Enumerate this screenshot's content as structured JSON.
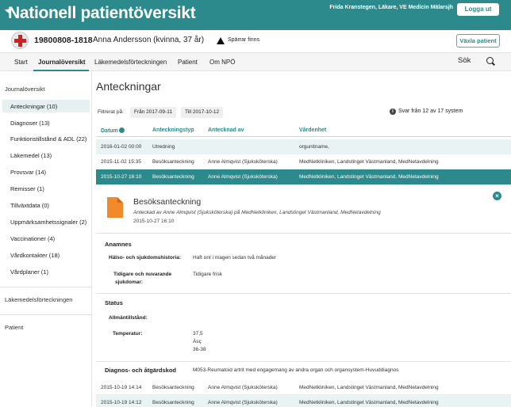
{
  "app": {
    "title": "Nationell patientöversikt",
    "user": "Frida Kranstegen, Läkare, VE Medicin Mälarsjh",
    "logout_label": "Logga ut"
  },
  "patient": {
    "id": "19800808-1818",
    "name": "Anna Andersson (kvinna, 37 år)",
    "warning": "Spärrar finns",
    "switch_label": "Växla patient"
  },
  "nav": {
    "items": [
      "Start",
      "Journalöversikt",
      "Läkemedelsförteckningen",
      "Patient",
      "Om NPÖ"
    ],
    "active": "Journalöversikt",
    "search_label": "Sök"
  },
  "sidebar": {
    "section_journal": "Journalöversikt",
    "items": [
      "Anteckningar (10)",
      "Diagnoser (13)",
      "Funktionstillstånd & ADL (22)",
      "Läkemedel (13)",
      "Provsvar (14)",
      "Remisser (1)",
      "Tillväxtdata (0)",
      "Uppmärksamhetssignaler (2)",
      "Vaccinationer (4)",
      "Vårdkontakter (18)",
      "Vårdplaner (1)"
    ],
    "active": "Anteckningar (10)",
    "section_lakemedel": "Läkemedelsförteckningen",
    "section_patient": "Patient"
  },
  "main": {
    "title": "Anteckningar",
    "filter_label": "Filtrerat på:",
    "filter_from": "Från 2017-09-11",
    "filter_to": "Till 2017-10-12",
    "info_text": "Svar från 12 av 17 system",
    "columns": [
      "Datum",
      "Anteckningstyp",
      "Antecknad av",
      "Vårdenhet"
    ],
    "rows": [
      {
        "datum": "2016-01-02 00:00",
        "typ": "Utredning",
        "av": "",
        "enhet": "orgunitname,"
      },
      {
        "datum": "2015-11-02 15:35",
        "typ": "Besöksanteckning",
        "av": "Anne Almqvist (Sjuksköterska)",
        "enhet": "MedNetkliniken, Landstinget Västmanland, MedNetavdelning"
      },
      {
        "datum": "2015-10-27 16:10",
        "typ": "Besöksanteckning",
        "av": "Anne Almqvist (Sjuksköterska)",
        "enhet": "MedNetkliniken, Landstinget Västmanland, MedNetavdelning"
      }
    ],
    "bottom_rows": [
      {
        "datum": "2015-10-19 14:14",
        "typ": "Besöksanteckning",
        "av": "Anne Almqvist (Sjuksköterska)",
        "enhet": "MedNetkliniken, Landstinget Västmanland, MedNetavdelning"
      },
      {
        "datum": "2015-10-19 14:12",
        "typ": "Besöksanteckning",
        "av": "Anne Almqvist (Sjuksköterska)",
        "enhet": "MedNetkliniken, Landstinget Västmanland, MedNetavdelning"
      }
    ]
  },
  "detail": {
    "title": "Besöksanteckning",
    "subtitle": "Anteckad av Anne Almqvist (Sjuksköterska) på MedNetkliniken, Landstinget Västmanland, MedNetavdelning",
    "date": "2015-10-27 16:10",
    "anamnes_heading": "Anamnes",
    "halso_label": "Hälso- och sjukdomshistoria:",
    "halso_value": "Haft ont i magen sedan två månader",
    "tidigare_label_1": "Tidigare och nuvarande",
    "tidigare_label_2": "sjukdomar:",
    "tidigare_value": "Tidigare frisk",
    "status_heading": "Status",
    "allman_label": "Allmäntillstånd:",
    "temp_label": "Temperatur:",
    "temp_values": [
      "37,5",
      "Àsç",
      "36-38"
    ],
    "diagnos_heading": "Diagnos- och åtgärdskod",
    "diagnos_value": "M053-Reumatoid artrit med engagemang av andra organ och organsystem-Huvuddiagnos"
  },
  "colors": {
    "accent": "#2c8a8d",
    "selected_row": "#2c8a8d",
    "light_row": "#e9f3f4",
    "doc_icon": "#f08a2b"
  }
}
